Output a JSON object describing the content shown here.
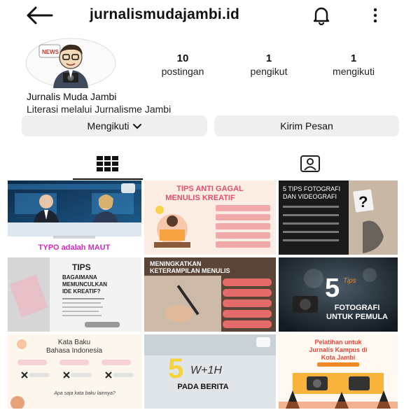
{
  "header": {
    "handle": "jurnalismudajambi.id",
    "icons": [
      "arrow-left-icon",
      "bell-icon",
      "more-vertical-icon"
    ]
  },
  "profile": {
    "name": "Jurnalis Muda Jambi",
    "bio": "Literasi melalui Jurnalisme Jambi",
    "stats": [
      {
        "value": "10",
        "label": "postingan"
      },
      {
        "value": "1",
        "label": "pengikut"
      },
      {
        "value": "1",
        "label": "mengikuti"
      }
    ]
  },
  "actions": {
    "follow_label": "Mengikuti",
    "message_label": "Kirim Pesan"
  },
  "tabs": [
    {
      "icon": "grid-icon",
      "active": true
    },
    {
      "icon": "tagged-person-icon",
      "active": false
    }
  ],
  "posts": [
    {
      "text": [
        "TYPO adalah MAUT"
      ]
    },
    {
      "text": [
        "TIPS ANTI GAGAL",
        "MENULIS KREATIF"
      ]
    },
    {
      "text": [
        "5 TIPS FOTOGRAFI",
        "DAN VIDEOGRAFI"
      ]
    },
    {
      "text": [
        "TIPS",
        "BAGAIMANA",
        "MEMUNCULKAN",
        "IDE KREATIF?"
      ]
    },
    {
      "text": [
        "MENINGKATKAN",
        "KETERAMPILAN MENULIS"
      ]
    },
    {
      "text": [
        "5",
        "Tips",
        "FOTOGRAFI",
        "UNTUK PEMULA"
      ]
    },
    {
      "text": [
        "Kata Baku",
        "Bahasa Indonesia",
        "Apa saja kata baku lainnya?"
      ]
    },
    {
      "text": [
        "5",
        "W+1H",
        "PADA BERITA"
      ]
    },
    {
      "text": [
        "Pelatihan untuk",
        "Jurnalis Kampus di",
        "Kota Jambi"
      ]
    }
  ],
  "colors": {
    "button_bg": "#efefef",
    "text": "#111111",
    "accent_orange": "#f08a24",
    "accent_pink": "#e0506a"
  }
}
